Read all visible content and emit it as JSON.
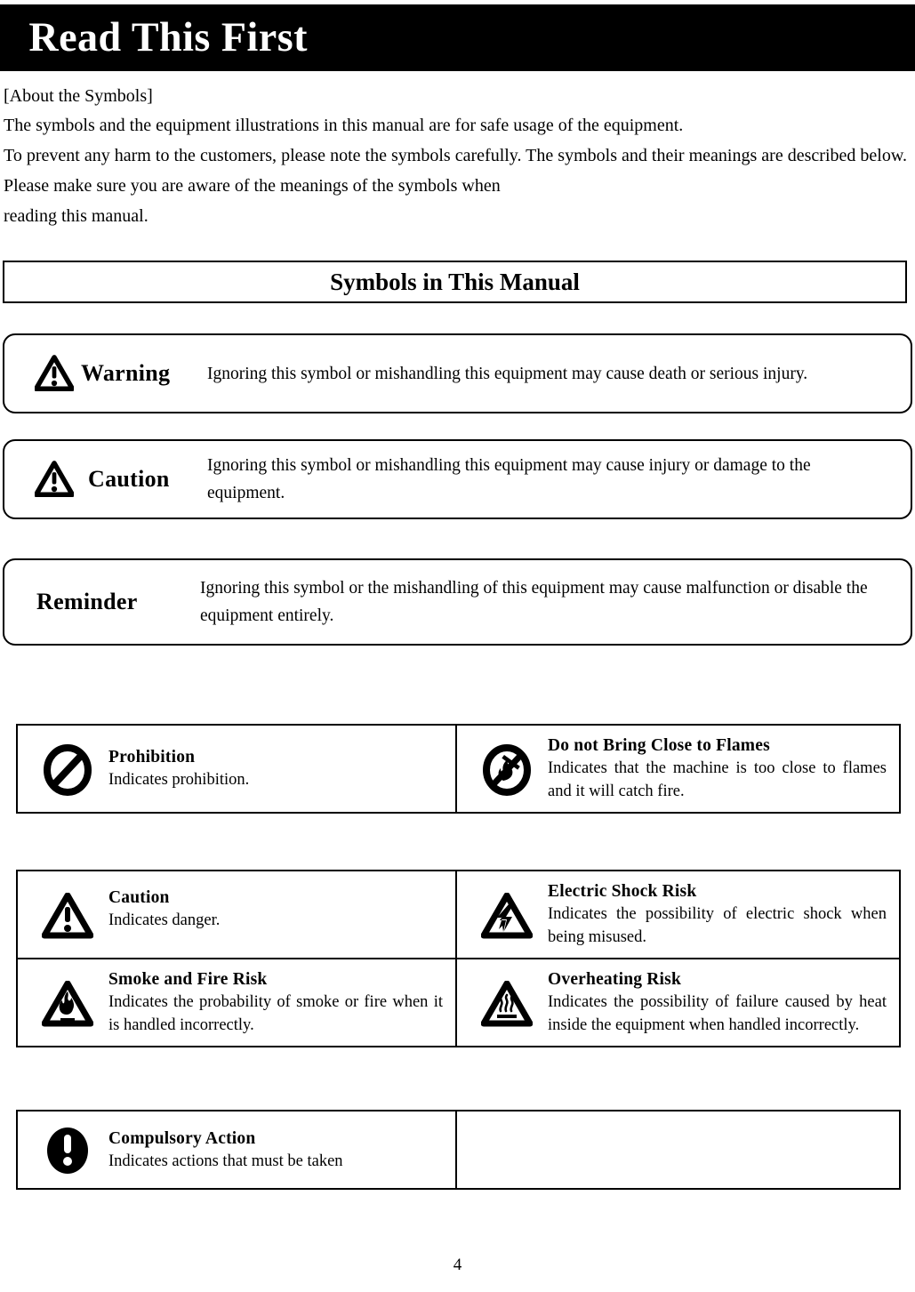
{
  "header": {
    "title": "Read This First"
  },
  "intro": {
    "lead": "[About the Symbols]",
    "line1": "The symbols and the equipment illustrations in this manual are for safe usage of the equipment.",
    "paragraph": "To prevent any harm to the customers, please note the symbols carefully. The symbols and their meanings are described below. Please make sure you are aware of the meanings of the symbols when",
    "paragraph_last_line": "reading this manual."
  },
  "section": {
    "heading": "Symbols in This Manual"
  },
  "notes": [
    {
      "icon": "warning-triangle-icon",
      "label": "Warning",
      "text": "Ignoring this symbol or mishandling this equipment may cause death or serious injury."
    },
    {
      "icon": "caution-triangle-icon",
      "label": "Caution",
      "text": "Ignoring this symbol or mishandling this equipment may cause injury or damage to the equipment."
    },
    {
      "icon": "none",
      "label": "Reminder",
      "text": "Ignoring this symbol or the mishandling of this equipment may cause malfunction or disable the equipment entirely."
    }
  ],
  "prohibition_table": {
    "rows": [
      [
        {
          "icon": "prohibition-circle-icon",
          "title": "Prohibition",
          "description": "Indicates prohibition."
        },
        {
          "icon": "no-flame-icon",
          "title": "Do not Bring Close to Flames",
          "description": "Indicates that the machine is too close to flames and it will catch fire."
        }
      ]
    ]
  },
  "caution_table": {
    "rows": [
      [
        {
          "icon": "caution-triangle-icon",
          "title": "Caution",
          "description": "Indicates danger."
        },
        {
          "icon": "electric-shock-icon",
          "title": "Electric Shock Risk",
          "description": "Indicates the possibility of electric shock when being misused."
        }
      ],
      [
        {
          "icon": "fire-triangle-icon",
          "title": "Smoke and Fire Risk",
          "description": "Indicates the probability of smoke or fire when it is handled incorrectly."
        },
        {
          "icon": "hot-surface-icon",
          "title": "Overheating Risk",
          "description": "Indicates the possibility of failure caused by heat inside the equipment when handled incorrectly."
        }
      ]
    ]
  },
  "compulsory_table": {
    "rows": [
      [
        {
          "icon": "compulsory-action-icon",
          "title": "Compulsory Action",
          "description": "Indicates actions that must be taken"
        },
        {
          "icon": "none",
          "title": "",
          "description": ""
        }
      ]
    ]
  },
  "footer": {
    "page_number": "4"
  },
  "colors": {
    "ink": "#000000",
    "paper": "#ffffff"
  }
}
